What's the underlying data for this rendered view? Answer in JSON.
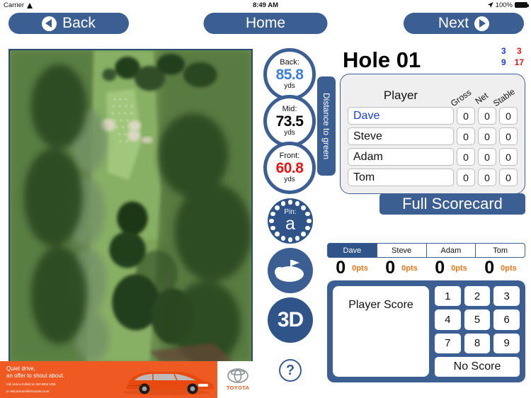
{
  "statusbar": {
    "carrier": "Carrier",
    "time": "8:49 AM",
    "battery": "100%"
  },
  "nav": {
    "back": "Back",
    "home": "Home",
    "next": "Next"
  },
  "distances": {
    "group_label": "Distance to green",
    "items": [
      {
        "label": "Back:",
        "value": "85.8",
        "unit": "yds",
        "color": "#3d7fe0"
      },
      {
        "label": "Mid:",
        "value": "73.5",
        "unit": "yds",
        "color": "#000000"
      },
      {
        "label": "Front:",
        "value": "60.8",
        "unit": "yds",
        "color": "#e81414"
      }
    ]
  },
  "pin": {
    "label": "Pin:",
    "value": "a"
  },
  "tools": {
    "three_d": "3D",
    "help": "?"
  },
  "hole": {
    "title": "Hole 01",
    "numbers": {
      "par_blue": "3",
      "par_red": "3",
      "index_blue": "9",
      "index_red": "17"
    }
  },
  "scorecard": {
    "headers": {
      "player": "Player",
      "gross": "Gross",
      "net": "Net",
      "stable": "Stable"
    },
    "rows": [
      {
        "name": "Dave",
        "gross": "0",
        "net": "0",
        "stable": "0",
        "active": true
      },
      {
        "name": "Steve",
        "gross": "0",
        "net": "0",
        "stable": "0",
        "active": false
      },
      {
        "name": "Adam",
        "gross": "0",
        "net": "0",
        "stable": "0",
        "active": false
      },
      {
        "name": "Tom",
        "gross": "0",
        "net": "0",
        "stable": "0",
        "active": false
      }
    ],
    "full_scorecard": "Full Scorecard"
  },
  "player_tabs": [
    {
      "label": "Dave",
      "score": "0",
      "points": "0pts",
      "active": true
    },
    {
      "label": "Steve",
      "score": "0",
      "points": "0pts",
      "active": false
    },
    {
      "label": "Adam",
      "score": "0",
      "points": "0pts",
      "active": false
    },
    {
      "label": "Tom",
      "score": "0",
      "points": "0pts",
      "active": false
    }
  ],
  "keypad": {
    "display_label": "Player Score",
    "keys": [
      "1",
      "2",
      "3",
      "4",
      "5",
      "6",
      "7",
      "8",
      "9"
    ],
    "no_score": "No Score"
  },
  "ad": {
    "headline_line1": "Quiet drive,",
    "headline_line2": "an offer to shout about.",
    "sub_line1": "Call Jemca Enfield on 020 8802 2336",
    "sub_line2": "or visit jemcaenfield.toyota.co.uk",
    "brand": "TOYOTA",
    "bg_color": "#ef5a22"
  },
  "colors": {
    "accent": "#3c5f93",
    "accent_dark": "#2e5489",
    "orange": "#e8761a"
  }
}
